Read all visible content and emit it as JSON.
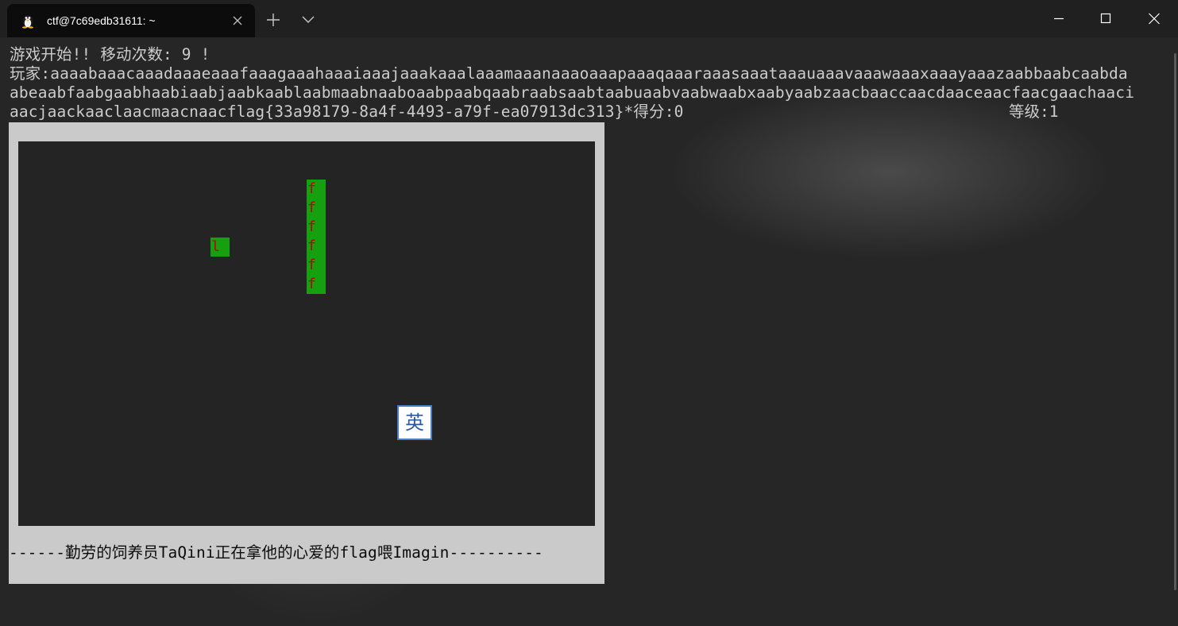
{
  "window": {
    "tab_title": "ctf@7c69edb31611: ~",
    "tab_icon": "linux-penguin-icon",
    "buttons": [
      "new-tab-icon",
      "dropdown-icon",
      "minimize-icon",
      "maximize-icon",
      "close-icon"
    ]
  },
  "terminal": {
    "lines": [
      "游戏开始!! 移动次数: 9 !",
      "玩家:aaaabaaacaaadaaaeaaafaaagaaahaaaiaaajaaakaaalaaamaaanaaaoaaapaaaqaaaraaasaaataaauaaavaaawaaaxaaayaaazaabbaabcaabda",
      "abeaabfaabgaabhaabiaabjaabkaablaabmaabnaaboaabpaabqaabraabsaabtaabuaabvaabwaabxaabyaabzaacbaaccaacdaaceaacfaacgaachaaci",
      "aacjaackaaclaacmaacnaacflag{33a98179-8a4f-4493-a79f-ea07913dc313}*得分:0"
    ],
    "level": "等级:1"
  },
  "game": {
    "snake_body": [
      "f",
      "f",
      "f",
      "f",
      "f",
      "f"
    ],
    "food": "l",
    "ime_indicator": "英",
    "footer": "------勤劳的饲养员TaQini正在拿他的心爱的flag喂Imagin----------"
  },
  "colors": {
    "terminal_bg": "#262626",
    "panel_bg": "#cacaca",
    "field_bg": "#242424",
    "snake_cell": "#16a00f",
    "snake_text": "#c00000",
    "text": "#cccccc"
  }
}
